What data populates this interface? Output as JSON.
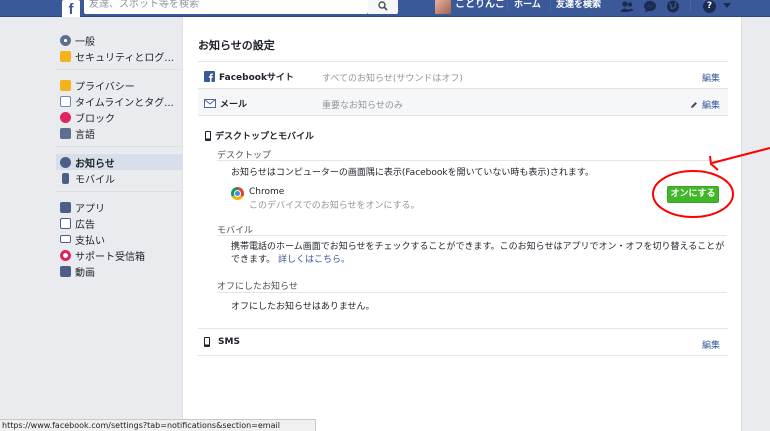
{
  "topbar": {
    "logo": "f",
    "search_placeholder": "友達、スポット等を検索",
    "user_name": "ことりんご",
    "home": "ホーム",
    "find_friends": "友達を検索"
  },
  "sidebar": {
    "groups": [
      [
        {
          "label": "一般",
          "icon": "gear-icon",
          "color": "#5d6e90"
        },
        {
          "label": "セキュリティとログ...",
          "icon": "shield-icon",
          "color": "#f3b31a"
        }
      ],
      [
        {
          "label": "プライバシー",
          "icon": "lock-icon",
          "color": "#f3b31a"
        },
        {
          "label": "タイムラインとタグ...",
          "icon": "timeline-icon",
          "color": "#6d84b4"
        },
        {
          "label": "ブロック",
          "icon": "block-icon",
          "color": "#e0245e"
        },
        {
          "label": "言語",
          "icon": "language-icon",
          "color": "#5d6e90"
        }
      ],
      [
        {
          "label": "お知らせ",
          "icon": "globe-icon",
          "color": "#4c5f87",
          "active": true
        },
        {
          "label": "モバイル",
          "icon": "mobile-icon",
          "color": "#4c5f87"
        }
      ],
      [
        {
          "label": "アプリ",
          "icon": "apps-icon",
          "color": "#4c5f87"
        },
        {
          "label": "広告",
          "icon": "ads-icon",
          "color": "#4c5f87"
        },
        {
          "label": "支払い",
          "icon": "payment-icon",
          "color": "#4c5f87"
        },
        {
          "label": "サポート受信箱",
          "icon": "lifebuoy-icon",
          "color": "#e0245e"
        },
        {
          "label": "動画",
          "icon": "video-icon",
          "color": "#4c5f87"
        }
      ]
    ]
  },
  "main": {
    "title": "お知らせの設定",
    "rows": [
      {
        "label": "Facebookサイト",
        "desc": "すべてのお知らせ(サウンドはオフ)",
        "edit": "編集"
      },
      {
        "label": "メール",
        "desc": "重要なお知らせのみ",
        "edit": "編集"
      }
    ],
    "desktop_mobile": {
      "title": "デスクトップとモバイル",
      "desktop_heading": "デスクトップ",
      "desktop_text": "お知らせはコンピューターの画面隅に表示(Facebookを開いていない時も表示)されます。",
      "chrome_name": "Chrome",
      "chrome_desc": "このデバイスでのお知らせをオンにする。",
      "on_button": "オンにする",
      "mobile_heading": "モバイル",
      "mobile_text": "携帯電話のホーム画面でお知らせをチェックすることができます。このお知らせはアプリでオン・オフを切り替えることができます。",
      "mobile_link": "詳しくはこちら。",
      "off_heading": "オフにしたお知らせ",
      "off_text": "オフにしたお知らせはありません。"
    },
    "sms": {
      "label": "SMS",
      "edit": "編集"
    }
  },
  "status_bar": "https://www.facebook.com/settings?tab=notifications&section=email",
  "colors": {
    "brand": "#3b5998",
    "button_green": "#42b72a",
    "annotation_red": "#ff0000",
    "link": "#365899"
  }
}
